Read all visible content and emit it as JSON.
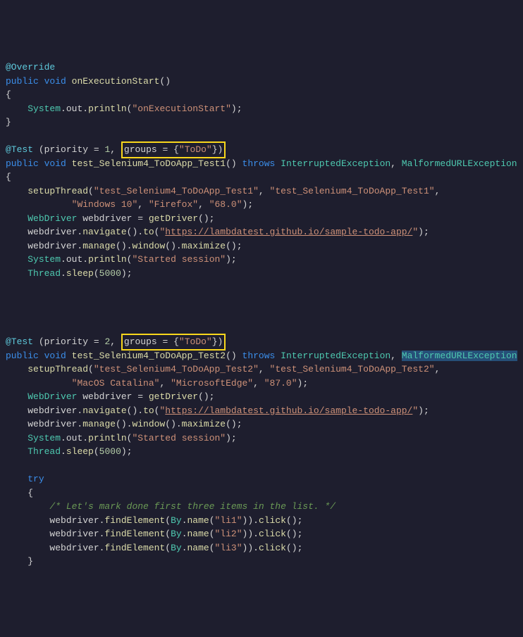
{
  "block1": {
    "annotation": "@Override",
    "signature": {
      "modifier": "public",
      "returnType": "void",
      "name": "onExecutionStart",
      "parens": "()"
    },
    "openBrace": "{",
    "body": {
      "indent": "    ",
      "obj": "System",
      "dot1": ".",
      "field": "out",
      "dot2": ".",
      "call": "println",
      "open": "(",
      "arg": "\"onExecutionStart\"",
      "close": ");"
    },
    "closeBrace": "}"
  },
  "block2": {
    "annotation": {
      "name": "@Test",
      "space": " ",
      "open": "(",
      "p1key": "priority",
      "p1eq": " = ",
      "p1val": "1",
      "comma": ", ",
      "groupsKey": "groups",
      "groupsEq": " = {",
      "groupsVal": "\"ToDo\"",
      "groupsClose": "})"
    },
    "signature": {
      "modifier": "public",
      "returnType": "void",
      "name": "test_Selenium4_ToDoApp_Test1",
      "parens": "()",
      "throws": "throws",
      "ex1": "InterruptedException",
      "comma": ", ",
      "ex2": "MalformedURLException"
    },
    "openBrace": "{",
    "lines": {
      "l1a": "setupThread",
      "l1b": "(",
      "l1c": "\"test_Selenium4_ToDoApp_Test1\"",
      "l1d": ", ",
      "l1e": "\"test_Selenium4_ToDoApp_Test1\"",
      "l1f": ",",
      "l2a": "        ",
      "l2b": "\"Windows 10\"",
      "l2c": ", ",
      "l2d": "\"Firefox\"",
      "l2e": ", ",
      "l2f": "\"68.0\"",
      "l2g": ");",
      "l3a": "WebDriver",
      "l3b": " webdriver = ",
      "l3c": "getDriver",
      "l3d": "();",
      "l4a": "webdriver.",
      "l4b": "navigate",
      "l4c": "().",
      "l4d": "to",
      "l4e": "(",
      "l4f": "\"",
      "l4g": "https://lambdatest.github.io/sample-todo-app/",
      "l4h": "\"",
      "l4i": ");",
      "l5a": "webdriver.",
      "l5b": "manage",
      "l5c": "().",
      "l5d": "window",
      "l5e": "().",
      "l5f": "maximize",
      "l5g": "();",
      "l6a": "System",
      "l6b": ".",
      "l6c": "out",
      "l6d": ".",
      "l6e": "println",
      "l6f": "(",
      "l6g": "\"Started session\"",
      "l6h": ");",
      "l7a": "Thread",
      "l7b": ".",
      "l7c": "sleep",
      "l7d": "(",
      "l7e": "5000",
      "l7f": ");"
    }
  },
  "block3": {
    "annotation": {
      "name": "@Test",
      "space": " ",
      "open": "(",
      "p1key": "priority",
      "p1eq": " = ",
      "p1val": "2",
      "comma": ", ",
      "groupsKey": "groups",
      "groupsEq": " = {",
      "groupsVal": "\"ToDo\"",
      "groupsClose": "})"
    },
    "signature": {
      "modifier": "public",
      "returnType": "void",
      "name": "test_Selenium4_ToDoApp_Test2",
      "parens": "()",
      "throws": "throws",
      "ex1": "InterruptedException",
      "comma": ", ",
      "ex2": "MalformedURLException",
      "openBrace": " {"
    },
    "lines": {
      "l1a": "setupThread",
      "l1b": "(",
      "l1c": "\"test_Selenium4_ToDoApp_Test2\"",
      "l1d": ", ",
      "l1e": "\"test_Selenium4_ToDoApp_Test2\"",
      "l1f": ",",
      "l2a": "        ",
      "l2b": "\"MacOS Catalina\"",
      "l2c": ", ",
      "l2d": "\"MicrosoftEdge\"",
      "l2e": ", ",
      "l2f": "\"87.0\"",
      "l2g": ");",
      "l3a": "WebDriver",
      "l3b": " webdriver = ",
      "l3c": "getDriver",
      "l3d": "();",
      "l4a": "webdriver.",
      "l4b": "navigate",
      "l4c": "().",
      "l4d": "to",
      "l4e": "(",
      "l4f": "\"",
      "l4g": "https://lambdatest.github.io/sample-todo-app/",
      "l4h": "\"",
      "l4i": ");",
      "l5a": "webdriver.",
      "l5b": "manage",
      "l5c": "().",
      "l5d": "window",
      "l5e": "().",
      "l5f": "maximize",
      "l5g": "();",
      "l6a": "System",
      "l6b": ".",
      "l6c": "out",
      "l6d": ".",
      "l6e": "println",
      "l6f": "(",
      "l6g": "\"Started session\"",
      "l6h": ");",
      "l7a": "Thread",
      "l7b": ".",
      "l7c": "sleep",
      "l7d": "(",
      "l7e": "5000",
      "l7f": ");",
      "tryKw": "try",
      "tryOpen": "{",
      "comment": "/* Let's mark done first three items in the list. */",
      "f1a": "webdriver.",
      "f1b": "findElement",
      "f1c": "(",
      "f1d": "By",
      "f1e": ".",
      "f1f": "name",
      "f1g": "(",
      "f1h": "\"li1\"",
      "f1i": ")).",
      "f1j": "click",
      "f1k": "();",
      "f2h": "\"li2\"",
      "f3h": "\"li3\"",
      "tryClose": "}"
    }
  }
}
